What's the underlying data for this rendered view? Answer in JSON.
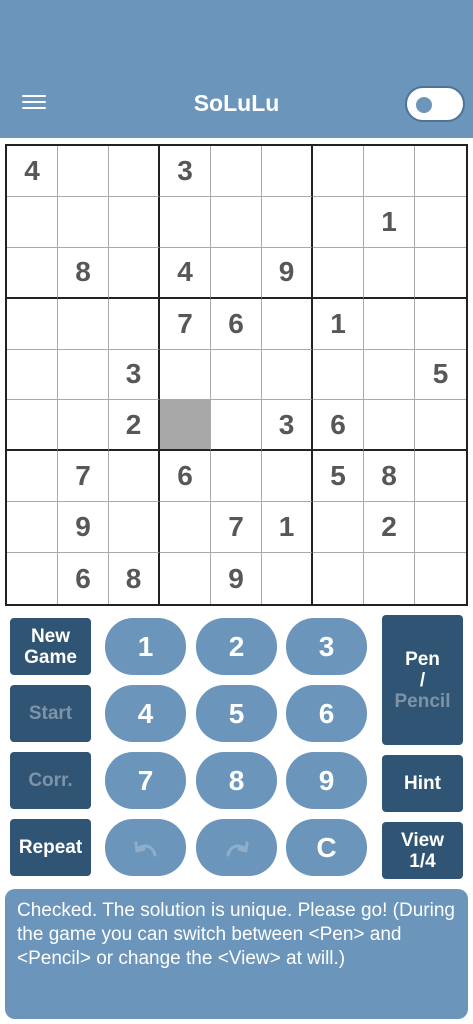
{
  "header": {
    "title": "SoLuLu",
    "menu_icon": "hamburger-menu-icon",
    "toggle_state": "off"
  },
  "board": {
    "rows": [
      [
        "4",
        "",
        "",
        "3",
        "",
        "",
        "",
        "",
        ""
      ],
      [
        "",
        "",
        "",
        "",
        "",
        "",
        "",
        "1",
        ""
      ],
      [
        "",
        "8",
        "",
        "4",
        "",
        "9",
        "",
        "",
        ""
      ],
      [
        "",
        "",
        "",
        "7",
        "6",
        "",
        "1",
        "",
        ""
      ],
      [
        "",
        "",
        "3",
        "",
        "",
        "",
        "",
        "",
        "5"
      ],
      [
        "",
        "",
        "2",
        "",
        "",
        "3",
        "6",
        "",
        ""
      ],
      [
        "",
        "7",
        "",
        "6",
        "",
        "",
        "5",
        "8",
        ""
      ],
      [
        "",
        "9",
        "",
        "",
        "7",
        "1",
        "",
        "2",
        ""
      ],
      [
        "",
        "6",
        "8",
        "",
        "9",
        "",
        "",
        "",
        ""
      ]
    ],
    "selected": {
      "row": 5,
      "col": 3
    }
  },
  "controls": {
    "new_game": [
      "New",
      "Game"
    ],
    "start": "Start",
    "corr": "Corr.",
    "repeat": "Repeat",
    "pen": "Pen",
    "slash": "/",
    "pencil": "Pencil",
    "hint": "Hint",
    "view": [
      "View",
      "1/4"
    ],
    "numbers": [
      "1",
      "2",
      "3",
      "4",
      "5",
      "6",
      "7",
      "8",
      "9"
    ],
    "undo_icon": "undo-arrow-icon",
    "redo_icon": "redo-arrow-icon",
    "clear": "C"
  },
  "message": "Checked. The solution is unique. Please go! (During the game you can switch between <Pen> and <Pencil> or change the <View> at will.)",
  "colors": {
    "header_bg": "#6b95bb",
    "button_dark": "#2f5474",
    "button_light": "#6b95bb",
    "selected_cell": "#a8a8a8"
  }
}
